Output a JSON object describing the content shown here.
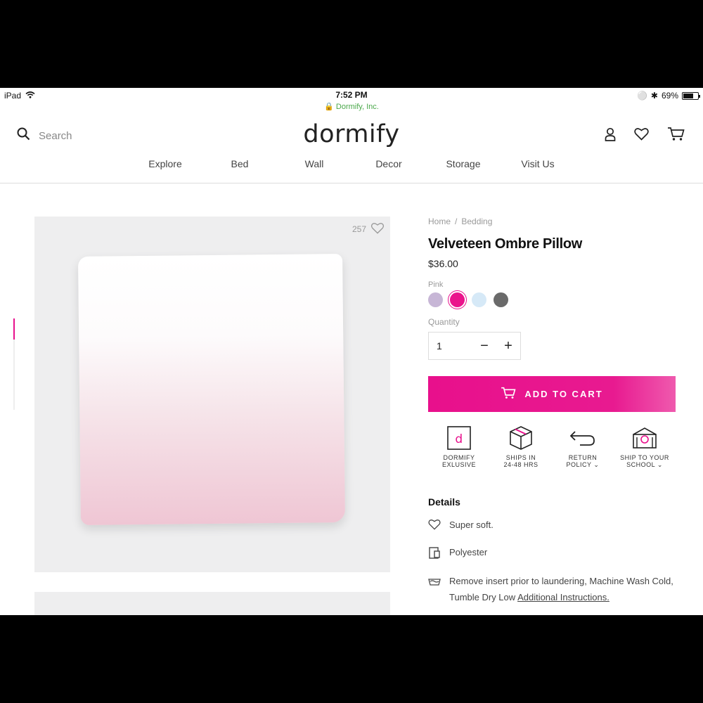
{
  "status_bar": {
    "device": "iPad",
    "time": "7:52 PM",
    "url": "Dormify, Inc.",
    "battery": "69%",
    "battery_level": 0.69
  },
  "header": {
    "search_placeholder": "Search",
    "logo": "dormify",
    "nav": [
      "Explore",
      "Bed",
      "Wall",
      "Decor",
      "Storage",
      "Visit Us"
    ]
  },
  "gallery": {
    "favorite_count": "257"
  },
  "product": {
    "breadcrumb": [
      "Home",
      "/",
      "Bedding"
    ],
    "title": "Velveteen Ombre Pillow",
    "price": "$36.00",
    "color_label": "Pink",
    "swatches": [
      {
        "color": "#c7b6d6",
        "selected": false
      },
      {
        "color": "#ea148c",
        "selected": true
      },
      {
        "color": "#d6e9f7",
        "selected": false
      },
      {
        "color": "#6a6a6a",
        "selected": false
      }
    ],
    "quantity_label": "Quantity",
    "quantity": "1",
    "add_to_cart": "ADD TO CART"
  },
  "perks": [
    {
      "line1": "DORMIFY",
      "line2": "EXLUSIVE",
      "icon": "dormify-logo-icon"
    },
    {
      "line1": "SHIPS IN",
      "line2": "24-48 HRS",
      "icon": "box-icon"
    },
    {
      "line1": "RETURN",
      "line2": "POLICY",
      "icon": "return-arrow-icon"
    },
    {
      "line1": "SHIP TO YOUR",
      "line2": "SCHOOL",
      "icon": "school-icon"
    }
  ],
  "details": {
    "title": "Details",
    "items": [
      {
        "text": "Super soft.",
        "icon": "heart-icon"
      },
      {
        "text": "Polyester",
        "icon": "fabric-icon"
      },
      {
        "text": "Remove insert prior to laundering, Machine Wash Cold, Tumble Dry Low",
        "link": "Additional Instructions.",
        "icon": "wash-icon"
      }
    ]
  },
  "colors": {
    "accent": "#e8108c"
  }
}
